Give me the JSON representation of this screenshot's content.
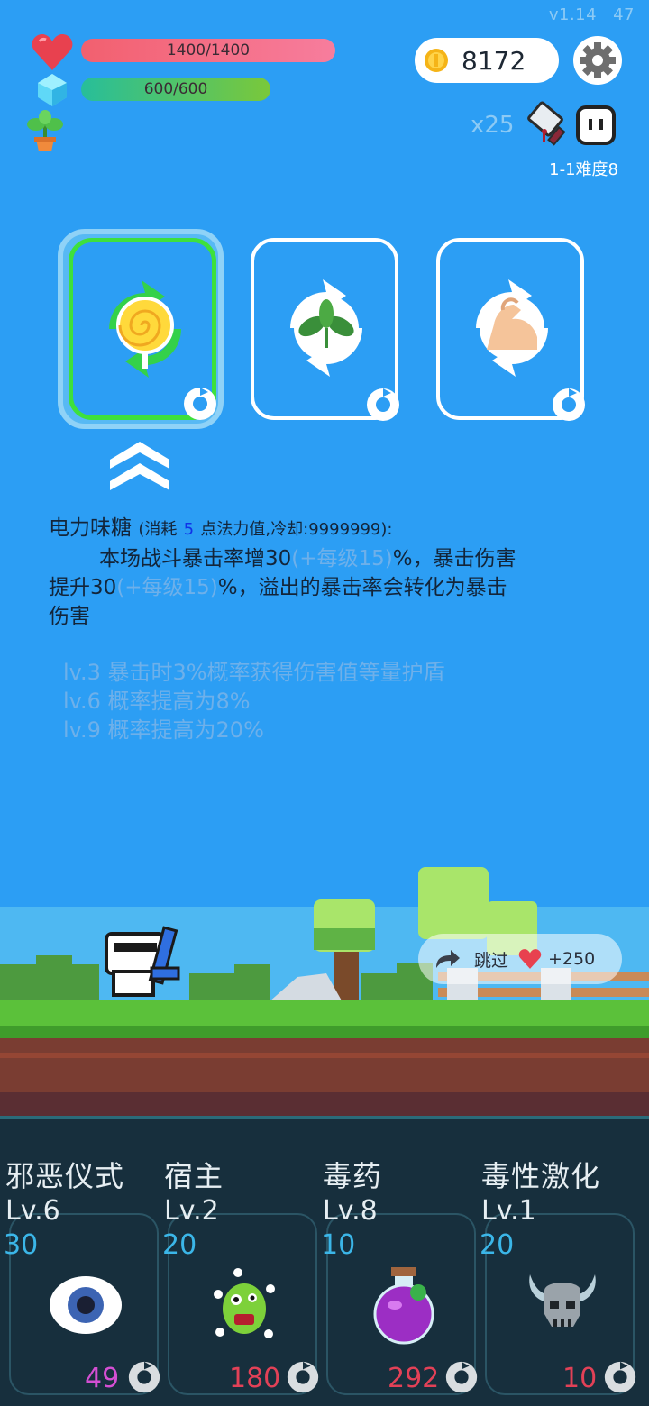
{
  "version": {
    "app": "v1.14",
    "fps": "47"
  },
  "player": {
    "hp_text": "1400/1400",
    "hp_fraction": 1.0,
    "mp_text": "600/600",
    "mp_fraction": 1.0
  },
  "coins": {
    "value": "8172"
  },
  "combat": {
    "multiplier": "x25",
    "stage": "1-1难度8"
  },
  "skills": [
    {
      "name": "lollipop",
      "selected": true
    },
    {
      "name": "leaf",
      "selected": false
    },
    {
      "name": "muscle",
      "selected": false
    }
  ],
  "skill_detail": {
    "name": "电力味糖",
    "cost_prefix": "(消耗",
    "cost_value": "5",
    "cost_suffix": "点法力值,冷却:9999999):",
    "line1_a": "本场战斗暴击率增30",
    "per_level": "(+每级15)",
    "line1_b": "%，暴击伤害",
    "line2_a": "提升30",
    "line2_b": "%，溢出的暴击率会转化为暴击",
    "line3": "伤害",
    "levels": [
      "lv.3 暴击时3%概率获得伤害值等量护盾",
      "lv.6 概率提高为8%",
      "lv.9 概率提高为20%"
    ]
  },
  "skip": {
    "label": "跳过",
    "reward": "+250"
  },
  "bottom_cards": [
    {
      "title": "邪恶仪式",
      "level": "Lv.6",
      "cost": "30",
      "count": "49",
      "count_color": "#d44fd3",
      "icon": "eye-icon"
    },
    {
      "title": "宿主",
      "level": "Lv.2",
      "cost": "20",
      "count": "180",
      "count_color": "#e24157",
      "icon": "germ-monster-icon"
    },
    {
      "title": "毒药",
      "level": "Lv.8",
      "cost": "10",
      "count": "292",
      "count_color": "#e24157",
      "icon": "poison-potion-icon"
    },
    {
      "title": "毒性激化",
      "level": "Lv.1",
      "cost": "20",
      "count": "10",
      "count_color": "#e24157",
      "icon": "horned-skull-icon"
    }
  ]
}
